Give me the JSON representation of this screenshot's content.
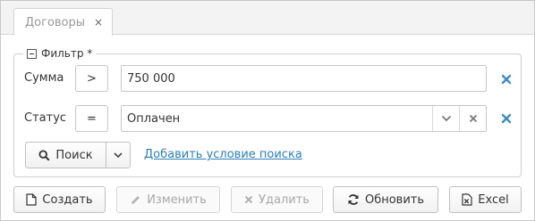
{
  "tabs": [
    {
      "label": "Договоры",
      "close_glyph": "×"
    }
  ],
  "filter": {
    "legend": "Фильтр *",
    "conditions": [
      {
        "label": "Сумма",
        "operator": ">",
        "value": "750 000"
      },
      {
        "label": "Статус",
        "operator": "=",
        "value": "Оплачен"
      }
    ],
    "search_label": "Поиск",
    "add_condition_label": "Добавить условие поиска"
  },
  "toolbar": {
    "create_label": "Создать",
    "edit_label": "Изменить",
    "delete_label": "Удалить",
    "refresh_label": "Обновить",
    "excel_label": "Excel"
  },
  "colors": {
    "accent_remove": "#3a8fc7",
    "link": "#2a7fb8"
  }
}
